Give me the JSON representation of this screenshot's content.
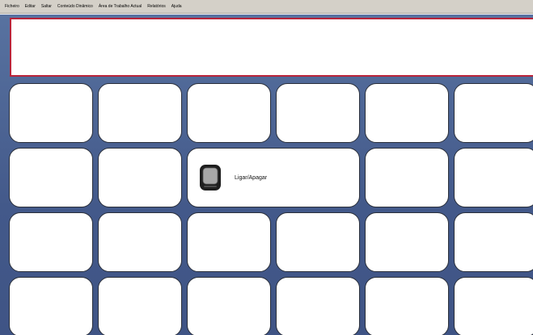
{
  "menu": {
    "items": [
      "Ficheiro",
      "Editar",
      "Saltar",
      "Conteúdo Dinâmico",
      "Área de Trabalho Actual",
      "Relatórios",
      "Ajuda"
    ]
  },
  "grid": {
    "power_cell": {
      "label": "Ligar/Apagar",
      "icon": "tv-remote-icon"
    }
  },
  "colors": {
    "background_top": "#5872a0",
    "background_bottom": "#3f5485",
    "message_border": "#b8243a",
    "cell_fill": "#ffffff",
    "menubar": "#d4d0c8"
  }
}
